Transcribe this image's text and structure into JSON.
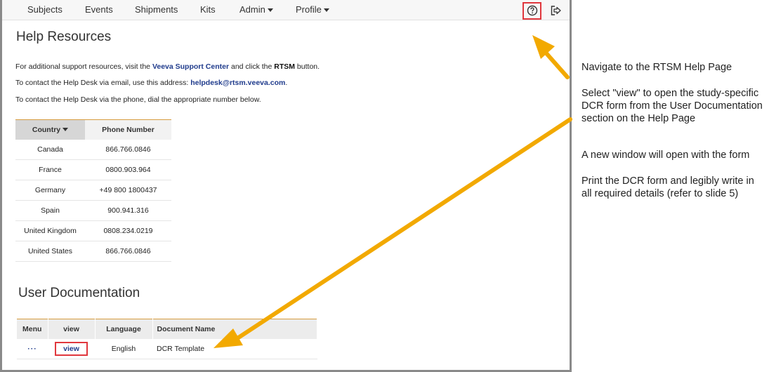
{
  "nav": {
    "items": [
      "Subjects",
      "Events",
      "Shipments",
      "Kits",
      "Admin",
      "Profile"
    ]
  },
  "help": {
    "title": "Help Resources",
    "line1_pre": "For additional support resources, visit the ",
    "line1_link": "Veeva Support Center",
    "line1_mid": " and click the ",
    "line1_bold": "RTSM",
    "line1_post": " button.",
    "line2_pre": "To contact the Help Desk via email, use this address: ",
    "line2_link": "helpdesk@rtsm.veeva.com",
    "line2_post": ".",
    "line3": "To contact the Help Desk via the phone, dial the appropriate number below."
  },
  "phone_table": {
    "headers": [
      "Country",
      "Phone Number"
    ],
    "rows": [
      [
        "Canada",
        "866.766.0846"
      ],
      [
        "France",
        "0800.903.964"
      ],
      [
        "Germany",
        "+49 800 1800437"
      ],
      [
        "Spain",
        "900.941.316"
      ],
      [
        "United Kingdom",
        "0808.234.0219"
      ],
      [
        "United States",
        "866.766.0846"
      ]
    ]
  },
  "docs": {
    "title": "User Documentation",
    "headers": [
      "Menu",
      "view",
      "Language",
      "Document Name"
    ],
    "row": {
      "menu": "···",
      "view": "view",
      "language": "English",
      "name": "DCR Template"
    }
  },
  "instructions": [
    "Navigate to the RTSM Help Page",
    "Select \"view\" to open the study-specific DCR form from the User Documentation section on the Help Page",
    "A new window will open with the form",
    "Print the DCR form and legibly write in all required details (refer to slide 5)"
  ],
  "colors": {
    "arrow": "#f2a900",
    "highlight": "#e0373d",
    "link": "#1f3b8c",
    "table_accent": "#d79c3f"
  },
  "icons": {
    "help": "question-circle-icon",
    "logout": "logout-icon",
    "sort": "caret-down-icon"
  }
}
